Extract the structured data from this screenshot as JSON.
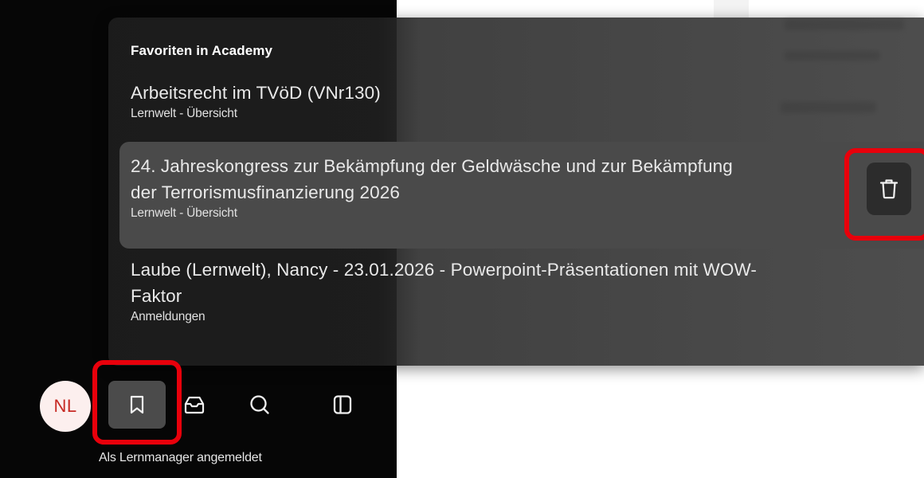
{
  "popover": {
    "title": "Favoriten in Academy",
    "items": [
      {
        "title": "Arbeitsrecht im TVöD (VNr130)",
        "subtitle": "Lernwelt - Übersicht"
      },
      {
        "title_line1": "24. Jahreskongress zur Bekämpfung der Geldwäsche und zur Bekämpfung",
        "title_line2": "der Terrorismusfinanzierung 2026",
        "subtitle": "Lernwelt - Übersicht",
        "action_icon": "trash-icon"
      },
      {
        "title_line1": "Laube (Lernwelt), Nancy - 23.01.2026 - Powerpoint-Präsentationen mit WOW-",
        "title_line2": "Faktor",
        "subtitle": "Anmeldungen"
      }
    ]
  },
  "toolbar": {
    "avatar_initials": "NL",
    "buttons": [
      {
        "icon": "bookmark-icon",
        "active": true
      },
      {
        "icon": "inbox-icon",
        "active": false
      },
      {
        "icon": "search-icon",
        "active": false
      },
      {
        "icon": "sidebar-panel-icon",
        "active": false
      }
    ],
    "status": "Als Lernmanager angemeldet"
  },
  "colors": {
    "highlight": "#e8000b",
    "avatar_text": "#c72a24",
    "avatar_bg": "#fcefee",
    "sidebar_bg": "#060606"
  }
}
